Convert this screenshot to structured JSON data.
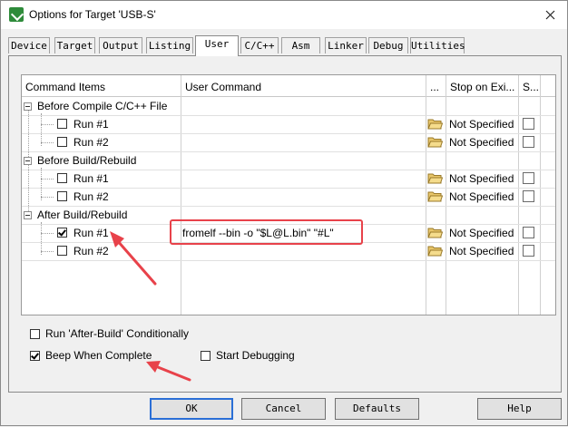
{
  "window": {
    "title": "Options for Target 'USB-S'"
  },
  "tabs": [
    "Device",
    "Target",
    "Output",
    "Listing",
    "User",
    "C/C++",
    "Asm",
    "Linker",
    "Debug",
    "Utilities"
  ],
  "grid": {
    "headers": {
      "items": "Command Items",
      "command": "User Command",
      "browse": "...",
      "stop": "Stop on Exi...",
      "s": "S..."
    },
    "groups": [
      {
        "label": "Before Compile C/C++ File",
        "runs": [
          {
            "label": "Run #1",
            "checked": false,
            "command": "",
            "stop": "Not Specified"
          },
          {
            "label": "Run #2",
            "checked": false,
            "command": "",
            "stop": "Not Specified"
          }
        ]
      },
      {
        "label": "Before Build/Rebuild",
        "runs": [
          {
            "label": "Run #1",
            "checked": false,
            "command": "",
            "stop": "Not Specified"
          },
          {
            "label": "Run #2",
            "checked": false,
            "command": "",
            "stop": "Not Specified"
          }
        ]
      },
      {
        "label": "After Build/Rebuild",
        "runs": [
          {
            "label": "Run #1",
            "checked": true,
            "command": "fromelf --bin -o \"$L@L.bin\" \"#L\"",
            "stop": "Not Specified"
          },
          {
            "label": "Run #2",
            "checked": false,
            "command": "",
            "stop": "Not Specified"
          }
        ]
      }
    ]
  },
  "options": {
    "run_after_build": {
      "label": "Run 'After-Build' Conditionally",
      "checked": false
    },
    "beep": {
      "label": "Beep When Complete",
      "checked": true
    },
    "start_debugging": {
      "label": "Start Debugging",
      "checked": false
    }
  },
  "buttons": {
    "ok": "OK",
    "cancel": "Cancel",
    "defaults": "Defaults",
    "help": "Help"
  },
  "colors": {
    "annotation": "#e8424a",
    "accent": "#2b6fd6"
  }
}
